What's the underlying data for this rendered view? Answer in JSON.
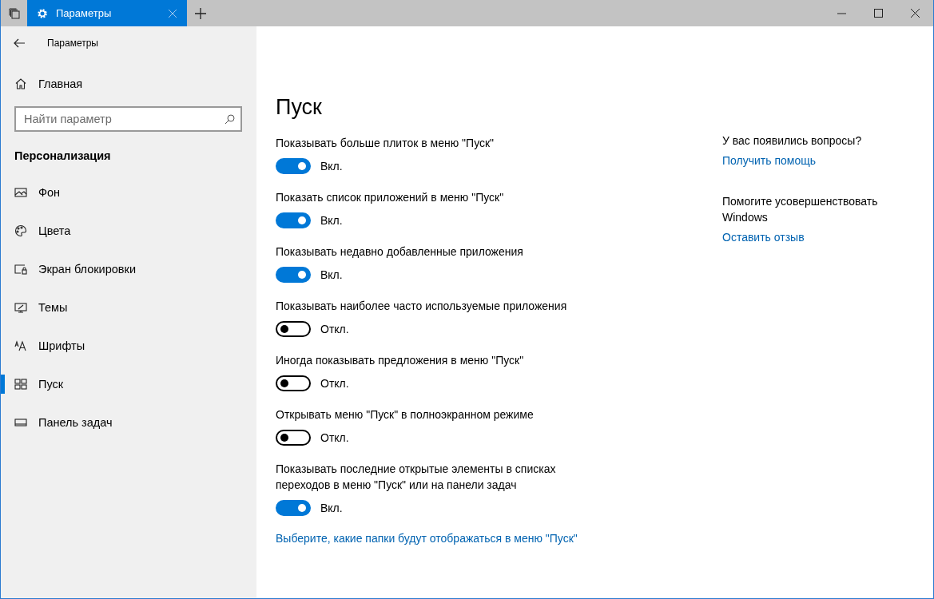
{
  "titlebar": {
    "tab": {
      "title": "Параметры",
      "selected": true
    }
  },
  "sidebar": {
    "header": "Параметры",
    "home": "Главная",
    "search": {
      "placeholder": "Найти параметр"
    },
    "section": "Персонализация",
    "items": [
      {
        "label": "Фон",
        "selected": false
      },
      {
        "label": "Цвета",
        "selected": false
      },
      {
        "label": "Экран блокировки",
        "selected": false
      },
      {
        "label": "Темы",
        "selected": false
      },
      {
        "label": "Шрифты",
        "selected": false
      },
      {
        "label": "Пуск",
        "selected": true
      },
      {
        "label": "Панель задач",
        "selected": false
      }
    ]
  },
  "main": {
    "title": "Пуск",
    "settings": [
      {
        "label": "Показывать больше плиток в меню \"Пуск\"",
        "on": true,
        "state": "Вкл."
      },
      {
        "label": "Показать список приложений в меню \"Пуск\"",
        "on": true,
        "state": "Вкл."
      },
      {
        "label": "Показывать недавно добавленные приложения",
        "on": true,
        "state": "Вкл."
      },
      {
        "label": "Показывать наиболее часто используемые приложения",
        "on": false,
        "state": "Откл."
      },
      {
        "label": "Иногда показывать предложения в меню \"Пуск\"",
        "on": false,
        "state": "Откл."
      },
      {
        "label": "Открывать меню \"Пуск\" в полноэкранном режиме",
        "on": false,
        "state": "Откл."
      },
      {
        "label": "Показывать последние открытые элементы в списках переходов в меню \"Пуск\" или на панели задач",
        "on": true,
        "state": "Вкл."
      }
    ],
    "link": "Выберите, какие папки будут отображаться в меню \"Пуск\""
  },
  "aside": [
    {
      "heading": "У вас появились вопросы?",
      "link": "Получить помощь"
    },
    {
      "heading": "Помогите усовершенствовать Windows",
      "link": "Оставить отзыв"
    }
  ]
}
